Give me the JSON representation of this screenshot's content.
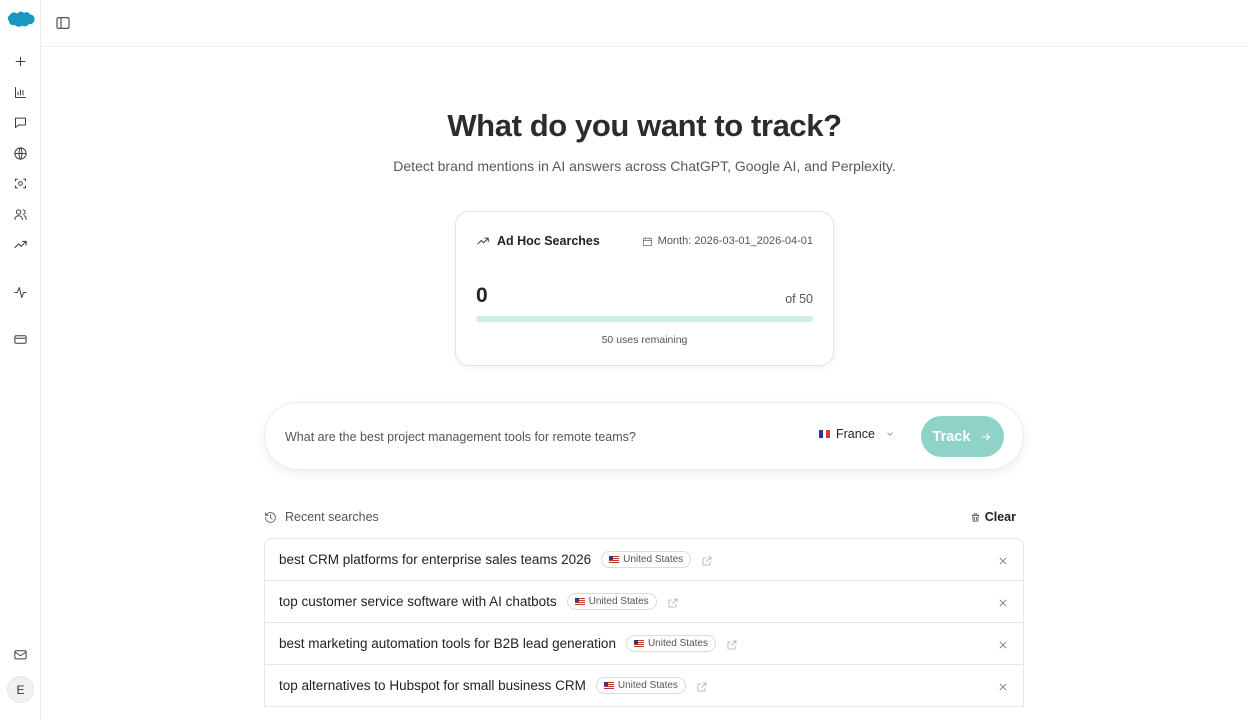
{
  "sidebar": {
    "logo": "salesforce-cloud-logo",
    "icons": [
      "plus-icon",
      "bar-chart-icon",
      "message-icon",
      "globe-icon",
      "scan-eye-icon",
      "users-icon",
      "trending-up-icon",
      "activity-icon",
      "credit-card-icon",
      "mail-icon"
    ],
    "avatar_initial": "E"
  },
  "main": {
    "title": "What do you want to track?",
    "subtitle": "Detect brand mentions in AI answers across ChatGPT, Google AI, and Perplexity."
  },
  "usage_card": {
    "label": "Ad Hoc Searches",
    "month": "Month: 2026-03-01_2026-04-01",
    "count": "0",
    "total": "of 50",
    "remaining": "50 uses remaining",
    "remaining_fraction": 1.0,
    "colors": {
      "bar_track": "#cdeee9",
      "bar_fill": "#7fcfc2"
    }
  },
  "search": {
    "placeholder": "What are the best project management tools for remote teams?",
    "country": "France",
    "track_label": "Track",
    "accent": "#8fd3c8"
  },
  "recent": {
    "label": "Recent searches",
    "clear_label": "Clear",
    "items": [
      {
        "query": "best CRM platforms for enterprise sales teams 2026",
        "country": "United States"
      },
      {
        "query": "top customer service software with AI chatbots",
        "country": "United States"
      },
      {
        "query": "best marketing automation tools for B2B lead generation",
        "country": "United States"
      },
      {
        "query": "top alternatives to Hubspot for small business CRM",
        "country": "United States"
      }
    ]
  }
}
